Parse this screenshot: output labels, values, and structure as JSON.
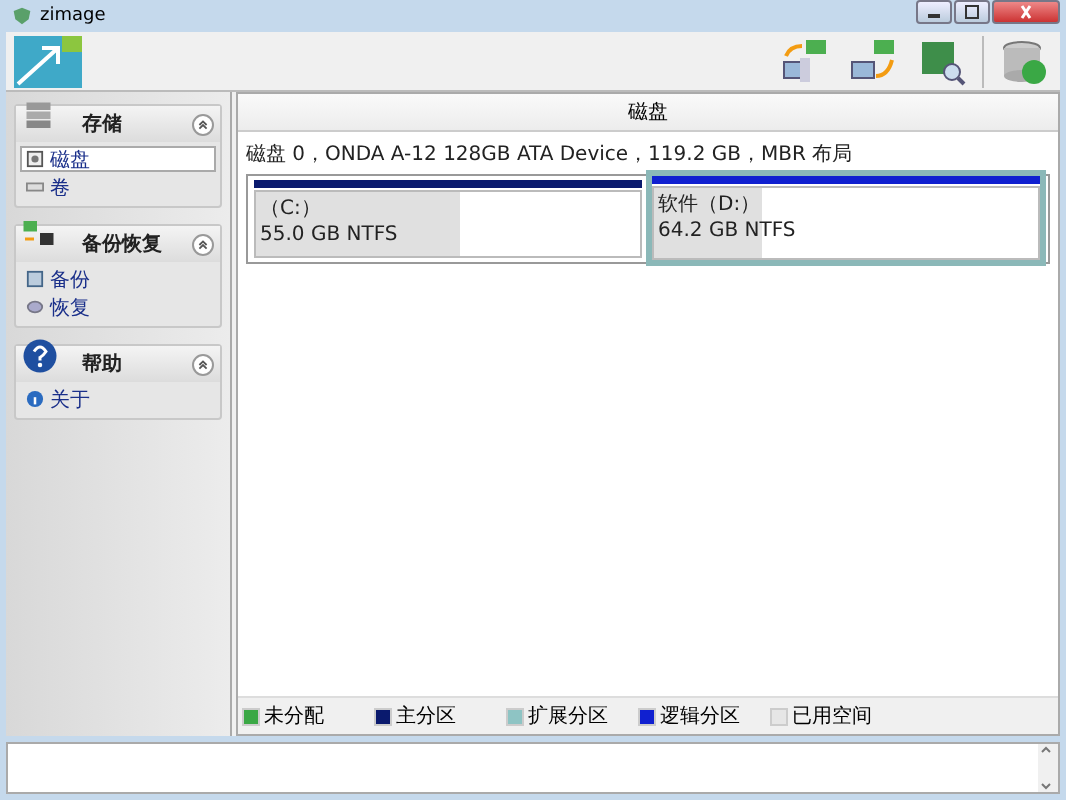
{
  "window": {
    "title": "zimage"
  },
  "sidebar": {
    "sections": [
      {
        "title": "存储",
        "expanded": true,
        "items": [
          {
            "label": "磁盘",
            "selected": true
          },
          {
            "label": "卷",
            "selected": false
          }
        ]
      },
      {
        "title": "备份恢复",
        "expanded": true,
        "items": [
          {
            "label": "备份",
            "selected": false
          },
          {
            "label": "恢复",
            "selected": false
          }
        ]
      },
      {
        "title": "帮助",
        "expanded": true,
        "items": [
          {
            "label": "关于",
            "selected": false
          }
        ]
      }
    ]
  },
  "main": {
    "header": "磁盘",
    "disk_info": "磁盘 0，ONDA A-12 128GB ATA Device，119.2 GB，MBR 布局",
    "partitions": [
      {
        "name": "（C:）",
        "size": "55.0 GB NTFS",
        "color": "#0a1a6e",
        "level": 0.53,
        "selected": false
      },
      {
        "name": "软件（D:）",
        "size": "64.2 GB NTFS",
        "color": "#1020d0",
        "level": 0.28,
        "selected": true
      }
    ]
  },
  "legend": [
    {
      "label": "未分配",
      "color": "#3aa845"
    },
    {
      "label": "主分区",
      "color": "#0a1a6e"
    },
    {
      "label": "扩展分区",
      "color": "#8ec4c4"
    },
    {
      "label": "逻辑分区",
      "color": "#1020d0"
    },
    {
      "label": "已用空间",
      "color": "#e6e6e6"
    }
  ]
}
